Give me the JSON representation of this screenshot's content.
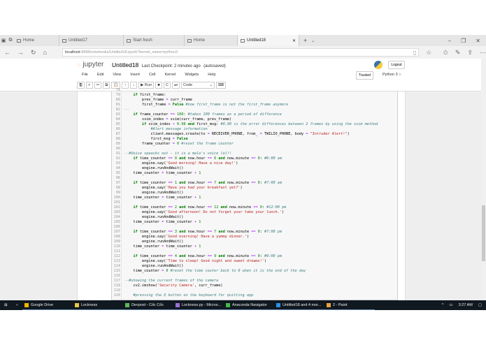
{
  "browser": {
    "tabs": [
      {
        "label": "Home"
      },
      {
        "label": "Untitled17"
      },
      {
        "label": "Start fresh"
      },
      {
        "label": "Home"
      },
      {
        "label": "Untitled18",
        "active": true
      }
    ],
    "url_host": "localhost",
    "url_rest": ":8888/notebooks/Untitled18.ipynb?kernel_name=python3"
  },
  "jupyter": {
    "logo_text": "jupyter",
    "title": "Untitled18",
    "checkpoint": "Last Checkpoint: 2 minutes ago",
    "autosaved": "(autosaved)",
    "logout": "Logout",
    "menu": [
      "File",
      "Edit",
      "View",
      "Insert",
      "Cell",
      "Kernel",
      "Widgets",
      "Help"
    ],
    "trusted": "Trusted",
    "kernel": "Python 3",
    "run_label": "Run",
    "cell_type": "Code"
  },
  "code_lines": [
    {
      "n": "78",
      "t": []
    },
    {
      "n": "79",
      "t": [
        [
          "    "
        ],
        [
          "if",
          "k"
        ],
        [
          " first_frame:"
        ]
      ]
    },
    {
      "n": "80",
      "t": [
        [
          "        prev_frame "
        ],
        [
          "=",
          "o"
        ],
        [
          " curr_frame"
        ]
      ]
    },
    {
      "n": "81",
      "t": [
        [
          "        first_frame "
        ],
        [
          "=",
          "o"
        ],
        [
          " "
        ],
        [
          "False",
          "k"
        ],
        [
          " "
        ],
        [
          "#now first_frame is not the first_frame anymore",
          "c"
        ]
      ]
    },
    {
      "n": "82",
      "t": [
        [
          "—→",
          "tabarrow"
        ]
      ]
    },
    {
      "n": "83",
      "t": [
        [
          "    "
        ],
        [
          "if",
          "k"
        ],
        [
          " frame_counter "
        ],
        [
          "==",
          "o"
        ],
        [
          " "
        ],
        [
          "100",
          "n"
        ],
        [
          ": "
        ],
        [
          "#takes 100 frames as a period of difference",
          "c"
        ]
      ]
    },
    {
      "n": "84",
      "t": [
        [
          "        ssim_index "
        ],
        [
          "=",
          "o"
        ],
        [
          " ssim(curr_frame, prev_frame)"
        ]
      ]
    },
    {
      "n": "85",
      "t": [
        [
          "        "
        ],
        [
          "if",
          "k"
        ],
        [
          " ssim_index "
        ],
        [
          "<",
          "o"
        ],
        [
          " "
        ],
        [
          "0.98",
          "n"
        ],
        [
          " "
        ],
        [
          "and",
          "k"
        ],
        [
          " first_msg: "
        ],
        [
          "#0.98 is the error differences between 2 frames by using the ssim method",
          "c"
        ]
      ]
    },
    {
      "n": "86",
      "t": [
        [
          "            "
        ],
        [
          "#Alert message information",
          "c"
        ]
      ]
    },
    {
      "n": "87",
      "t": [
        [
          "            client.messages.create(to "
        ],
        [
          "=",
          "o"
        ],
        [
          " RECEIVER_PHONE, from_ "
        ],
        [
          "=",
          "o"
        ],
        [
          " TWILIO_PHONE, body "
        ],
        [
          "=",
          "o"
        ],
        [
          " "
        ],
        [
          "\"Intruder Alert!\"",
          "s"
        ],
        [
          ")"
        ]
      ]
    },
    {
      "n": "88",
      "t": [
        [
          "            first_msg "
        ],
        [
          "=",
          "o"
        ],
        [
          " "
        ],
        [
          "False",
          "k"
        ]
      ]
    },
    {
      "n": "89",
      "t": [
        [
          "        frame_counter "
        ],
        [
          "=",
          "o"
        ],
        [
          " "
        ],
        [
          "0",
          "n"
        ],
        [
          " "
        ],
        [
          "#reset the frame counter",
          "c"
        ]
      ]
    },
    {
      "n": "90",
      "t": []
    },
    {
      "n": "91",
      "t": [
        [
          "—→",
          "tabarrow"
        ],
        [
          "#Voice speacks out - it is a male's voice lol!!",
          "c"
        ]
      ]
    },
    {
      "n": "92",
      "t": [
        [
          "    "
        ],
        [
          "if",
          "k"
        ],
        [
          " time_counter "
        ],
        [
          "==",
          "o"
        ],
        [
          " "
        ],
        [
          "0",
          "n"
        ],
        [
          " "
        ],
        [
          "and",
          "k"
        ],
        [
          " now.hour "
        ],
        [
          "==",
          "o"
        ],
        [
          " "
        ],
        [
          "6",
          "n"
        ],
        [
          " "
        ],
        [
          "and",
          "k"
        ],
        [
          " now.minute "
        ],
        [
          "==",
          "o"
        ],
        [
          " "
        ],
        [
          "0",
          "n"
        ],
        [
          ": "
        ],
        [
          "#6:00 am",
          "c"
        ]
      ]
    },
    {
      "n": "93",
      "t": [
        [
          "        engine.say("
        ],
        [
          "'Good morning! Have a nice day!'",
          "s"
        ],
        [
          ")"
        ]
      ]
    },
    {
      "n": "94",
      "t": [
        [
          "        engine.runAndWait()"
        ]
      ]
    },
    {
      "n": "95",
      "t": [
        [
          "    time_counter "
        ],
        [
          "=",
          "o"
        ],
        [
          " time_counter "
        ],
        [
          "+",
          "o"
        ],
        [
          " "
        ],
        [
          "1",
          "n"
        ]
      ]
    },
    {
      "n": "96",
      "t": []
    },
    {
      "n": "97",
      "t": [
        [
          "    "
        ],
        [
          "if",
          "k"
        ],
        [
          " time_counter "
        ],
        [
          "==",
          "o"
        ],
        [
          " "
        ],
        [
          "1",
          "n"
        ],
        [
          " "
        ],
        [
          "and",
          "k"
        ],
        [
          " now.hour "
        ],
        [
          "==",
          "o"
        ],
        [
          " "
        ],
        [
          "7",
          "n"
        ],
        [
          " "
        ],
        [
          "and",
          "k"
        ],
        [
          " now.minute "
        ],
        [
          "==",
          "o"
        ],
        [
          " "
        ],
        [
          "0",
          "n"
        ],
        [
          ": "
        ],
        [
          "#7:00 am",
          "c"
        ]
      ]
    },
    {
      "n": "98",
      "t": [
        [
          "        engine.say("
        ],
        [
          "'Have you had your breakfast yet?'",
          "s"
        ],
        [
          ")"
        ]
      ]
    },
    {
      "n": "99",
      "t": [
        [
          "        engine.runAndWait()"
        ]
      ]
    },
    {
      "n": "100",
      "t": [
        [
          "    time_counter "
        ],
        [
          "=",
          "o"
        ],
        [
          " time_counter "
        ],
        [
          "+",
          "o"
        ],
        [
          " "
        ],
        [
          "1",
          "n"
        ]
      ]
    },
    {
      "n": "101",
      "t": []
    },
    {
      "n": "102",
      "t": [
        [
          "    "
        ],
        [
          "if",
          "k"
        ],
        [
          " time_counter "
        ],
        [
          "==",
          "o"
        ],
        [
          " "
        ],
        [
          "2",
          "n"
        ],
        [
          " "
        ],
        [
          "and",
          "k"
        ],
        [
          " now.hour "
        ],
        [
          "==",
          "o"
        ],
        [
          " "
        ],
        [
          "12",
          "n"
        ],
        [
          " "
        ],
        [
          "and",
          "k"
        ],
        [
          " now.minute "
        ],
        [
          "==",
          "o"
        ],
        [
          " "
        ],
        [
          "0",
          "n"
        ],
        [
          ": "
        ],
        [
          "#12:00 pm",
          "c"
        ]
      ]
    },
    {
      "n": "103",
      "t": [
        [
          "        engine.say("
        ],
        [
          "'Good afternoon! Do not forget your take your lunch.'",
          "s"
        ],
        [
          ")"
        ]
      ]
    },
    {
      "n": "104",
      "t": [
        [
          "        engine.runAndWait()"
        ]
      ]
    },
    {
      "n": "105",
      "t": [
        [
          "    time_counter "
        ],
        [
          "=",
          "o"
        ],
        [
          " time_counter "
        ],
        [
          "+",
          "o"
        ],
        [
          " "
        ],
        [
          "1",
          "n"
        ]
      ]
    },
    {
      "n": "106",
      "t": []
    },
    {
      "n": "107",
      "t": [
        [
          "    "
        ],
        [
          "if",
          "k"
        ],
        [
          " time_counter "
        ],
        [
          "==",
          "o"
        ],
        [
          " "
        ],
        [
          "3",
          "n"
        ],
        [
          " "
        ],
        [
          "and",
          "k"
        ],
        [
          " now.hour "
        ],
        [
          "==",
          "o"
        ],
        [
          " "
        ],
        [
          "7",
          "n"
        ],
        [
          " "
        ],
        [
          "and",
          "k"
        ],
        [
          " now.minute "
        ],
        [
          "==",
          "o"
        ],
        [
          " "
        ],
        [
          "0",
          "n"
        ],
        [
          ": "
        ],
        [
          "#7:00 pm",
          "c"
        ]
      ]
    },
    {
      "n": "108",
      "t": [
        [
          "        engine.say("
        ],
        [
          "'Good everning! Have a yummy dinner.'",
          "s"
        ],
        [
          ")"
        ]
      ]
    },
    {
      "n": "109",
      "t": [
        [
          "        engine.runAndWait()"
        ]
      ]
    },
    {
      "n": "110",
      "t": [
        [
          "    time_counter "
        ],
        [
          "=",
          "o"
        ],
        [
          " time_counter "
        ],
        [
          "+",
          "o"
        ],
        [
          " "
        ],
        [
          "1",
          "n"
        ]
      ]
    },
    {
      "n": "111",
      "t": []
    },
    {
      "n": "112",
      "t": [
        [
          "    "
        ],
        [
          "if",
          "k"
        ],
        [
          " time_counter "
        ],
        [
          "==",
          "o"
        ],
        [
          " "
        ],
        [
          "4",
          "n"
        ],
        [
          " "
        ],
        [
          "and",
          "k"
        ],
        [
          " now.hour "
        ],
        [
          "==",
          "o"
        ],
        [
          " "
        ],
        [
          "9",
          "n"
        ],
        [
          " "
        ],
        [
          "and",
          "k"
        ],
        [
          " now.minute "
        ],
        [
          "==",
          "o"
        ],
        [
          " "
        ],
        [
          "0",
          "n"
        ],
        [
          ": "
        ],
        [
          "#9:00 pm",
          "c"
        ]
      ]
    },
    {
      "n": "113",
      "t": [
        [
          "        engine.say("
        ],
        [
          "'Time to sleep! Good night and sweet dreams!'",
          "s"
        ],
        [
          ")"
        ]
      ]
    },
    {
      "n": "114",
      "t": [
        [
          "        engine.runAndWait()"
        ]
      ]
    },
    {
      "n": "115",
      "t": [
        [
          "    time_counter "
        ],
        [
          "=",
          "o"
        ],
        [
          " "
        ],
        [
          "0",
          "n"
        ],
        [
          " "
        ],
        [
          "#reset the time couter back to 0 when it is the end of the day",
          "c"
        ]
      ]
    },
    {
      "n": "116",
      "t": []
    },
    {
      "n": "117",
      "t": [
        [
          "—→",
          "tabarrow"
        ],
        [
          "#showing the current frames of the camera",
          "c"
        ]
      ]
    },
    {
      "n": "118",
      "t": [
        [
          "    cv2.imshow("
        ],
        [
          "'Security Camera'",
          "s"
        ],
        [
          ", curr_frame)"
        ]
      ]
    },
    {
      "n": "119",
      "t": []
    },
    {
      "n": "120",
      "t": [
        [
          "    "
        ],
        [
          "#pressing the Q button on the keyboard for quitting app",
          "c"
        ]
      ]
    }
  ],
  "taskbar": {
    "items": [
      {
        "label": "Google Drive",
        "color": "#f4b400"
      },
      {
        "label": "Lockness",
        "color": "#e8c44a"
      },
      {
        "label": "Devpost - Cốc Cốc",
        "color": "#5cb85c"
      },
      {
        "label": "Lockness.py - Micros...",
        "color": "#9b6fd6"
      },
      {
        "label": "Anaconda Navigator",
        "color": "#44b84a"
      },
      {
        "label": "Untitled18 and 4 mor...",
        "color": "#2f8fe0"
      },
      {
        "label": "2 - Paint",
        "color": "#e8a040"
      }
    ],
    "time": "3:27 AM"
  }
}
